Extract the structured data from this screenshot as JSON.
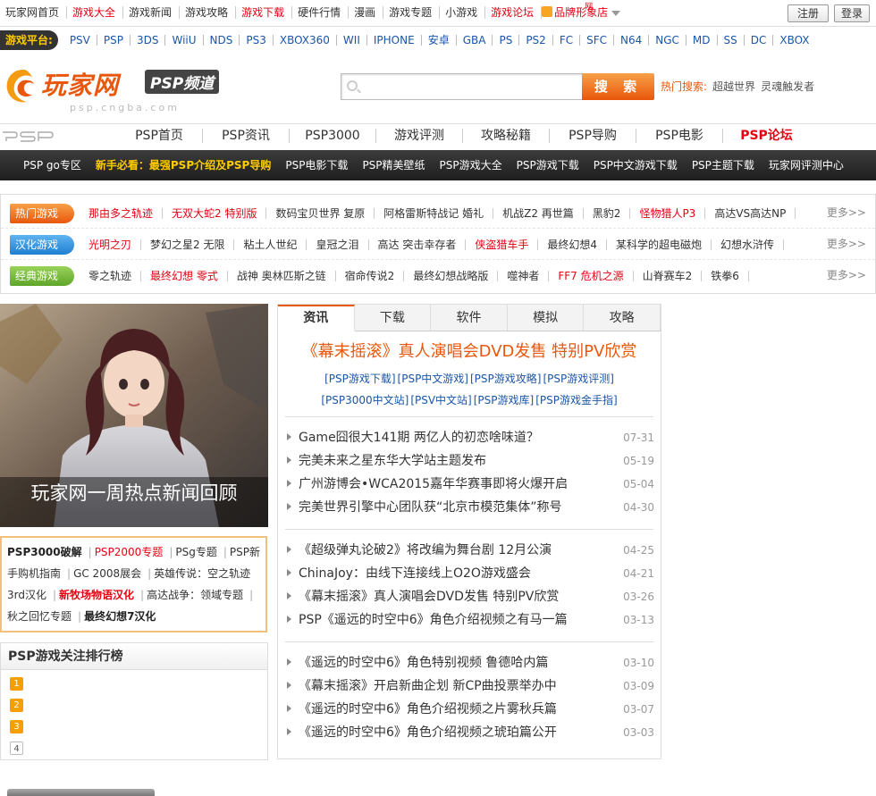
{
  "topnav": {
    "links": [
      {
        "label": "玩家网首页",
        "style": "normal"
      },
      {
        "label": "游戏大全",
        "style": "red"
      },
      {
        "label": "游戏新闻",
        "style": "normal"
      },
      {
        "label": "游戏攻略",
        "style": "normal"
      },
      {
        "label": "游戏下载",
        "style": "red"
      },
      {
        "label": "硬件行情",
        "style": "normal"
      },
      {
        "label": "漫画",
        "style": "normal"
      },
      {
        "label": "游戏专题",
        "style": "normal"
      },
      {
        "label": "小游戏",
        "style": "normal"
      },
      {
        "label": "游戏论坛",
        "style": "red"
      }
    ],
    "brand_store": "品牌形象店",
    "brand_mark": "网",
    "register": "注册",
    "login": "登录"
  },
  "platforms": {
    "label": "游戏平台:",
    "items": [
      "PSV",
      "PSP",
      "3DS",
      "WiiU",
      "NDS",
      "PS3",
      "XBOX360",
      "WII",
      "IPHONE",
      "安卓",
      "GBA",
      "PS",
      "PS2",
      "FC",
      "SFC",
      "N64",
      "NGC",
      "MD",
      "SS",
      "DC",
      "XBOX"
    ]
  },
  "header": {
    "logo_text": "玩家网",
    "logo_channel": "PSP频道",
    "logo_domain": "psp.cngba.com",
    "search_placeholder": "",
    "search_button": "搜 索",
    "hot_search_label": "热门搜索:",
    "hot_keywords": [
      "超越世界",
      "灵魂触发者"
    ]
  },
  "channelnav": {
    "tabs": [
      {
        "label": "PSP首页",
        "active": false
      },
      {
        "label": "PSP资讯",
        "active": false
      },
      {
        "label": "PSP3000",
        "active": false
      },
      {
        "label": "游戏评测",
        "active": false
      },
      {
        "label": "攻略秘籍",
        "active": false
      },
      {
        "label": "PSP导购",
        "active": false
      },
      {
        "label": "PSP电影",
        "active": false
      },
      {
        "label": "PSP论坛",
        "active": true
      }
    ]
  },
  "subnav": [
    {
      "label": "PSP go专区",
      "highlight": false
    },
    {
      "label": "新手必看：最强PSP介绍及PSP导购",
      "highlight": true
    },
    {
      "label": "PSP电影下载",
      "highlight": false
    },
    {
      "label": "PSP精美壁纸",
      "highlight": false
    },
    {
      "label": "PSP游戏大全",
      "highlight": false
    },
    {
      "label": "PSP游戏下载",
      "highlight": false
    },
    {
      "label": "PSP中文游戏下载",
      "highlight": false
    },
    {
      "label": "PSP主题下载",
      "highlight": false
    },
    {
      "label": "玩家网评测中心",
      "highlight": false
    }
  ],
  "game_rows": [
    {
      "badge": "热门游戏",
      "badge_style": "hot",
      "items": [
        {
          "label": "那由多之轨迹",
          "red": true
        },
        {
          "label": "无双大蛇2 特别版",
          "red": true
        },
        {
          "label": "数码宝贝世界 复原",
          "red": false
        },
        {
          "label": "阿格雷斯特战记 婚礼",
          "red": false
        },
        {
          "label": "机战Z2 再世篇",
          "red": false
        },
        {
          "label": "黑豹2",
          "red": false
        },
        {
          "label": "怪物猎人P3",
          "red": true
        },
        {
          "label": "高达VS高达NP",
          "red": false
        }
      ],
      "more": "更多>>"
    },
    {
      "badge": "汉化游戏",
      "badge_style": "cn",
      "items": [
        {
          "label": "光明之刃",
          "red": true
        },
        {
          "label": "梦幻之星2 无限",
          "red": false
        },
        {
          "label": "粘土人世纪",
          "red": false
        },
        {
          "label": "皇冠之泪",
          "red": false
        },
        {
          "label": "高达 突击幸存者",
          "red": false
        },
        {
          "label": "侠盗猎车手",
          "red": true
        },
        {
          "label": "最终幻想4",
          "red": false
        },
        {
          "label": "某科学的超电磁炮",
          "red": false
        },
        {
          "label": "幻想水浒传",
          "red": false
        }
      ],
      "more": "更多>>"
    },
    {
      "badge": "经典游戏",
      "badge_style": "classic",
      "items": [
        {
          "label": "零之轨迹",
          "red": false
        },
        {
          "label": "最终幻想 零式",
          "red": true
        },
        {
          "label": "战神 奥林匹斯之链",
          "red": false
        },
        {
          "label": "宿命传说2",
          "red": false
        },
        {
          "label": "最终幻想战略版",
          "red": false
        },
        {
          "label": "噬神者",
          "red": false
        },
        {
          "label": "FF7 危机之源",
          "red": true
        },
        {
          "label": "山脊赛车2",
          "red": false
        },
        {
          "label": "铁拳6",
          "red": false
        }
      ],
      "more": "更多>>"
    }
  ],
  "hero": {
    "caption": "玩家网一周热点新闻回顾"
  },
  "topics": [
    {
      "label": "PSP3000破解",
      "style": "bold"
    },
    {
      "label": "PSP2000专题",
      "style": "red"
    },
    {
      "label": "PSg专题",
      "style": "normal"
    },
    {
      "label": "PSP新手购机指南",
      "style": "normal"
    },
    {
      "label": "GC 2008展会",
      "style": "normal"
    },
    {
      "label": "英雄传说：空之轨迹3rd汉化",
      "style": "normal"
    },
    {
      "label": "新牧场物语汉化",
      "style": "redbold"
    },
    {
      "label": "高达战争：领域专题",
      "style": "normal"
    },
    {
      "label": "秋之回忆专题",
      "style": "normal"
    },
    {
      "label": "最终幻想7汉化",
      "style": "bold"
    }
  ],
  "ranking": {
    "title": "PSP游戏关注排行榜",
    "items": [
      "1",
      "2",
      "3",
      "4"
    ]
  },
  "news": {
    "tabs": [
      {
        "label": "资讯",
        "active": true
      },
      {
        "label": "下载",
        "active": false
      },
      {
        "label": "软件",
        "active": false
      },
      {
        "label": "模拟",
        "active": false
      },
      {
        "label": "攻略",
        "active": false
      }
    ],
    "headline": "《幕末摇滚》真人演唱会DVD发售 特别PV欣赏",
    "links_row1": [
      "[PSP游戏下载]",
      "[PSP中文游戏]",
      "[PSP游戏攻略]",
      "[PSP游戏评测]"
    ],
    "links_row2": [
      "[PSP3000中文站]",
      "[PSV中文站]",
      "[PSP游戏库]",
      "[PSP游戏金手指]"
    ],
    "groups": [
      [
        {
          "title": "Game囧很大141期 两亿人的初恋啥味道？",
          "date": "07-31"
        },
        {
          "title": "完美未来之星东华大学站主题发布",
          "date": "05-19"
        },
        {
          "title": "广州游博会•WCA2015嘉年华赛事即将火爆开启",
          "date": "05-04"
        },
        {
          "title": "完美世界引擎中心团队获“北京市模范集体”称号",
          "date": "04-30"
        }
      ],
      [
        {
          "title": "《超级弹丸论破2》将改编为舞台剧 12月公演",
          "date": "04-25"
        },
        {
          "title": "ChinaJoy：由线下连接线上O2O游戏盛会",
          "date": "04-21"
        },
        {
          "title": "《幕末摇滚》真人演唱会DVD发售 特别PV欣赏",
          "date": "03-26"
        },
        {
          "title": "PSP《遥远的时空中6》角色介绍视频之有马一篇",
          "date": "03-13"
        }
      ],
      [
        {
          "title": "《遥远的时空中6》角色特别视频 鲁德哈内篇",
          "date": "03-10"
        },
        {
          "title": "《幕末摇滚》开启新曲企划 新CP曲投票举办中",
          "date": "03-09"
        },
        {
          "title": "《遥远的时空中6》角色介绍视频之片雾秋兵篇",
          "date": "03-07"
        },
        {
          "title": "《遥远的时空中6》角色介绍视频之琥珀篇公开",
          "date": "03-03"
        }
      ]
    ]
  },
  "colors": {
    "accent_orange": "#e8570c",
    "link_red": "#e60012",
    "link_blue": "#1a55a8",
    "subnav_yellow": "#ffcc00"
  }
}
